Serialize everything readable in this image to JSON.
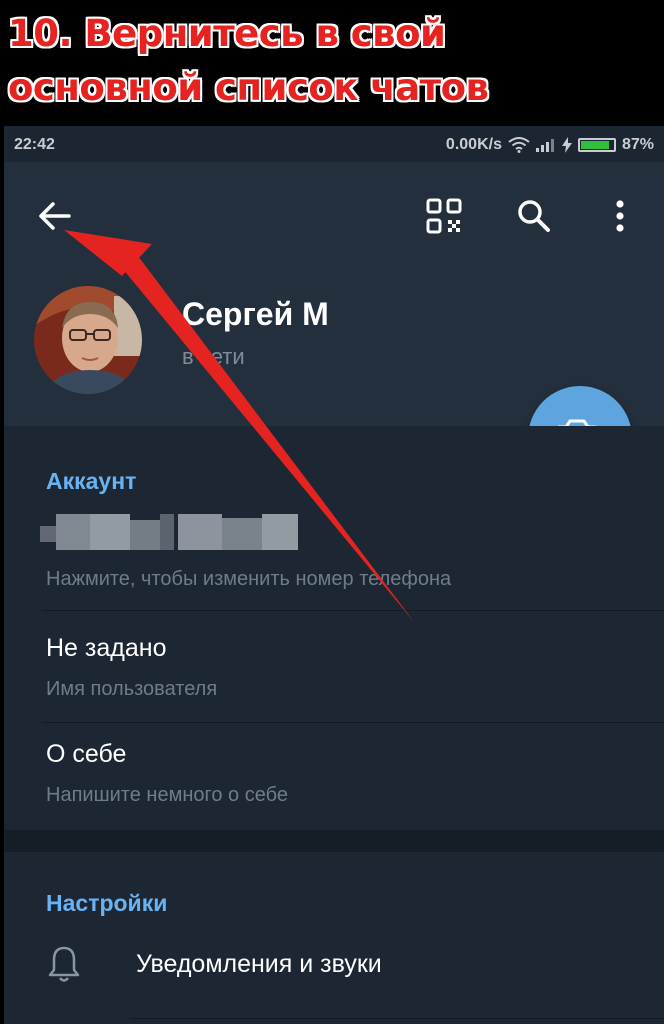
{
  "caption": {
    "line1": "10. Вернитесь в свой",
    "line2": "основной список чатов"
  },
  "statusbar": {
    "time": "22:42",
    "speed": "0.00K/s",
    "battery": "87%",
    "battery_level": 0.87
  },
  "header": {
    "back_icon": "arrow-left-icon",
    "qr_icon": "qr-code-icon",
    "search_icon": "search-icon",
    "more_icon": "more-vert-icon"
  },
  "profile": {
    "name": "Сергей М",
    "status": "в сети",
    "camera_icon": "add-photo-icon"
  },
  "account": {
    "title": "Аккаунт",
    "phone_hint": "Нажмите, чтобы изменить номер телефона",
    "username_value": "Не задано",
    "username_label": "Имя пользователя",
    "bio_value": "О себе",
    "bio_hint": "Напишите немного о себе"
  },
  "settings": {
    "title": "Настройки",
    "items": [
      {
        "label": "Уведомления и звуки",
        "icon": "bell-icon"
      }
    ]
  },
  "colors": {
    "accent": "#6ab3f3",
    "fab": "#5ea5e0",
    "header_bg": "#242f3d",
    "body_bg": "#1d2733",
    "annotation_arrow": "#e52421"
  }
}
